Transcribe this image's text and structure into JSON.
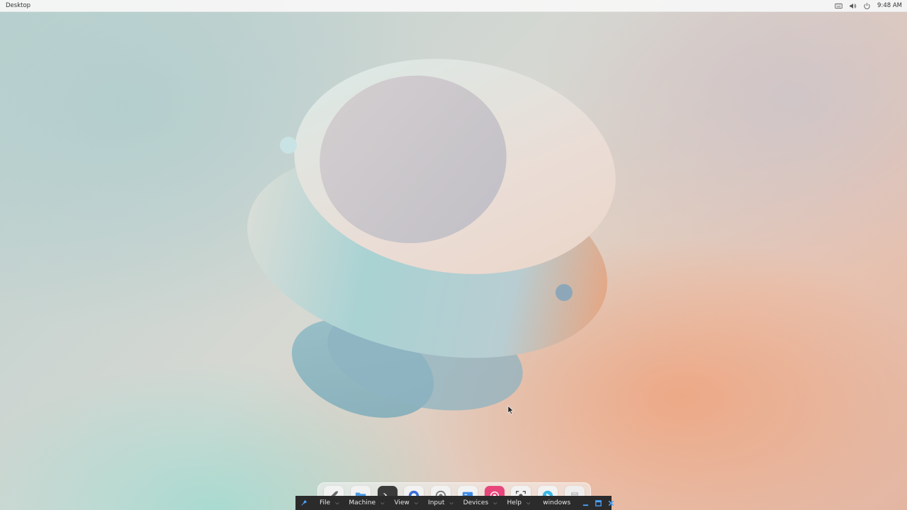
{
  "topbar": {
    "title": "Desktop",
    "clock": "9:48 AM",
    "icons": [
      "keyboard-icon",
      "volume-icon",
      "power-icon"
    ]
  },
  "dock": {
    "apps": [
      {
        "name": "launcher-rocket-icon",
        "bg": "#f2f2f2"
      },
      {
        "name": "files-folder-icon",
        "bg": "#f2f2f2"
      },
      {
        "name": "terminal-icon",
        "bg": "#3a3a3a"
      },
      {
        "name": "browser-icon",
        "bg": "#f2f2f2"
      },
      {
        "name": "settings-gear-icon",
        "bg": "#f2f2f2"
      },
      {
        "name": "app-store-icon",
        "bg": "#f2f2f2"
      },
      {
        "name": "screen-recorder-icon",
        "bg": "#e8467a"
      },
      {
        "name": "screenshot-icon",
        "bg": "#f2f2f2"
      },
      {
        "name": "media-player-icon",
        "bg": "#f2f2f2"
      },
      {
        "name": "trash-icon",
        "bg": "#eeeeee"
      }
    ]
  },
  "vmbar": {
    "menus": [
      "File",
      "Machine",
      "View",
      "Input",
      "Devices",
      "Help"
    ],
    "caret": "⌵",
    "window_label": "windows",
    "colors": {
      "bg": "#2b2b2b",
      "accent": "#4da3ff"
    }
  }
}
